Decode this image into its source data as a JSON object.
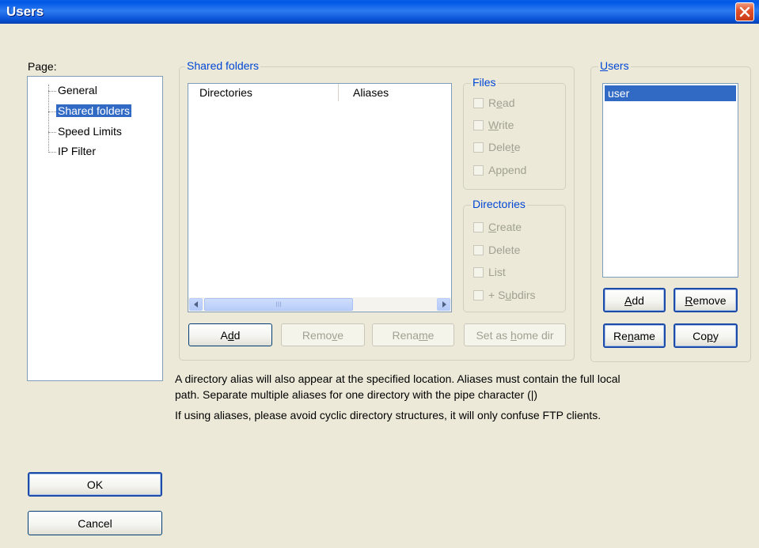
{
  "window": {
    "title": "Users"
  },
  "page_panel": {
    "label": "Page:",
    "items": [
      {
        "label": "General",
        "selected": false
      },
      {
        "label": "Shared folders",
        "selected": true
      },
      {
        "label": "Speed Limits",
        "selected": false
      },
      {
        "label": "IP Filter",
        "selected": false
      }
    ]
  },
  "shared_folders": {
    "legend": "Shared folders",
    "columns": [
      "Directories",
      "Aliases"
    ],
    "scroll_thumb_mark": "III",
    "buttons": {
      "add": {
        "pre": "A",
        "u": "d",
        "post": "d"
      },
      "remove": {
        "pre": "Remo",
        "u": "v",
        "post": "e"
      },
      "rename": {
        "pre": "Rena",
        "u": "m",
        "post": "e"
      },
      "home": {
        "pre": "Set as ",
        "u": "h",
        "post": "ome dir"
      }
    }
  },
  "files_group": {
    "legend": "Files",
    "options": [
      {
        "pre": "R",
        "u": "e",
        "post": "ad"
      },
      {
        "pre": "",
        "u": "W",
        "post": "rite"
      },
      {
        "pre": "Dele",
        "u": "t",
        "post": "e"
      },
      {
        "pre": "Append",
        "u": "",
        "post": ""
      }
    ]
  },
  "directories_group": {
    "legend": "Directories",
    "options": [
      {
        "pre": "",
        "u": "C",
        "post": "reate"
      },
      {
        "pre": "Delete",
        "u": "",
        "post": ""
      },
      {
        "pre": "List",
        "u": "",
        "post": ""
      },
      {
        "pre": "+ S",
        "u": "u",
        "post": "bdirs"
      }
    ]
  },
  "users_group": {
    "legend_u": "U",
    "legend_rest": "sers",
    "list": [
      "user"
    ],
    "buttons": {
      "add": {
        "pre": "",
        "u": "A",
        "post": "dd"
      },
      "remove": {
        "pre": "",
        "u": "R",
        "post": "emove"
      },
      "rename": {
        "pre": "Re",
        "u": "n",
        "post": "ame"
      },
      "copy": {
        "pre": "Co",
        "u": "p",
        "post": "y"
      }
    }
  },
  "info": {
    "line1": "A directory alias will also appear at the specified location. Aliases must contain the full local",
    "line2": "path. Separate multiple aliases for one directory with the pipe character (|)",
    "line3": "If using aliases, please avoid cyclic directory structures, it will only confuse FTP clients."
  },
  "footer": {
    "ok": "OK",
    "cancel": "Cancel"
  },
  "colors": {
    "titlebar": "#0058e6",
    "selection": "#316ac5",
    "group_legend": "#0046d5",
    "window_bg": "#ece9d8"
  }
}
